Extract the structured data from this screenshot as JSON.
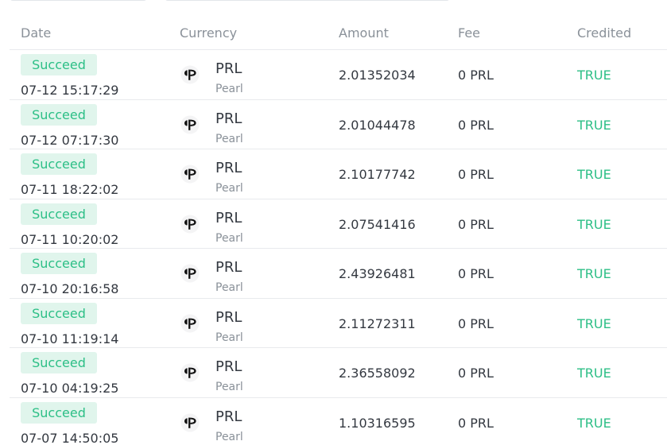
{
  "columns": {
    "date": "Date",
    "currency": "Currency",
    "amount": "Amount",
    "fee": "Fee",
    "credited": "Credited"
  },
  "colors": {
    "success": "#2cbf86",
    "success_bg": "#e0f5ec",
    "muted": "#8a9199",
    "text": "#333840"
  },
  "icons": {
    "coin": "pearl-coin-icon"
  },
  "rows": [
    {
      "status": "Succeed",
      "datetime": "07-12 15:17:29",
      "symbol": "PRL",
      "name": "Pearl",
      "amount": "2.01352034",
      "fee": "0 PRL",
      "credited": "TRUE"
    },
    {
      "status": "Succeed",
      "datetime": "07-12 07:17:30",
      "symbol": "PRL",
      "name": "Pearl",
      "amount": "2.01044478",
      "fee": "0 PRL",
      "credited": "TRUE"
    },
    {
      "status": "Succeed",
      "datetime": "07-11 18:22:02",
      "symbol": "PRL",
      "name": "Pearl",
      "amount": "2.10177742",
      "fee": "0 PRL",
      "credited": "TRUE"
    },
    {
      "status": "Succeed",
      "datetime": "07-11 10:20:02",
      "symbol": "PRL",
      "name": "Pearl",
      "amount": "2.07541416",
      "fee": "0 PRL",
      "credited": "TRUE"
    },
    {
      "status": "Succeed",
      "datetime": "07-10 20:16:58",
      "symbol": "PRL",
      "name": "Pearl",
      "amount": "2.43926481",
      "fee": "0 PRL",
      "credited": "TRUE"
    },
    {
      "status": "Succeed",
      "datetime": "07-10 11:19:14",
      "symbol": "PRL",
      "name": "Pearl",
      "amount": "2.11272311",
      "fee": "0 PRL",
      "credited": "TRUE"
    },
    {
      "status": "Succeed",
      "datetime": "07-10 04:19:25",
      "symbol": "PRL",
      "name": "Pearl",
      "amount": "2.36558092",
      "fee": "0 PRL",
      "credited": "TRUE"
    },
    {
      "status": "Succeed",
      "datetime": "07-07 14:50:05",
      "symbol": "PRL",
      "name": "Pearl",
      "amount": "1.10316595",
      "fee": "0 PRL",
      "credited": "TRUE"
    }
  ]
}
